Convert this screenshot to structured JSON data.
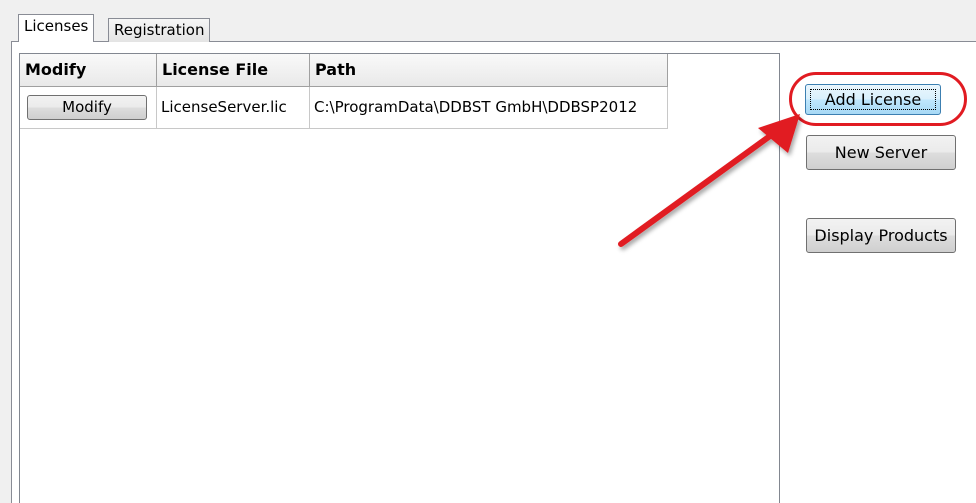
{
  "tabs": [
    {
      "label": "Licenses",
      "active": true
    },
    {
      "label": "Registration",
      "active": false
    }
  ],
  "grid": {
    "columns": [
      "Modify",
      "License File",
      "Path"
    ],
    "rows": [
      {
        "button_label": "Modify",
        "license_file": "LicenseServer.lic",
        "path": "C:\\ProgramData\\DDBST GmbH\\DDBSP2012"
      }
    ]
  },
  "buttons": {
    "add_license": "Add License",
    "new_server": "New Server",
    "display_products": "Display Products"
  },
  "annotation": {
    "color": "#e11b22",
    "arrow_target": "add_license"
  }
}
